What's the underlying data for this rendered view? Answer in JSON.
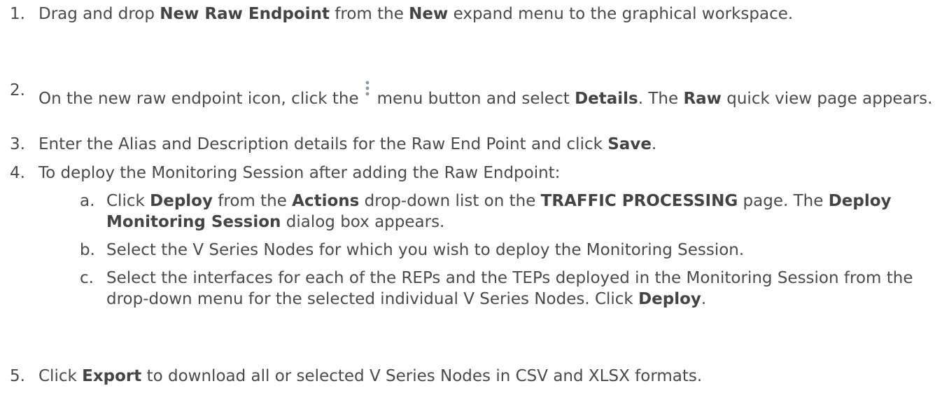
{
  "steps": [
    {
      "num": "1.",
      "parts": [
        "Drag and drop ",
        "New Raw Endpoint",
        " from the ",
        "New",
        " expand menu to the graphical workspace."
      ]
    },
    {
      "num": "2.",
      "parts": [
        "On the new raw endpoint icon, click the",
        "menu button and select ",
        "Details",
        ". The ",
        "Raw",
        " quick view page appears."
      ],
      "icon": "kebab-menu-icon"
    },
    {
      "num": "3.",
      "parts": [
        " Enter the Alias and Description details for the Raw End Point and click ",
        "Save",
        "."
      ]
    },
    {
      "num": "4.",
      "parts": [
        "To deploy the Monitoring Session after adding the Raw Endpoint:"
      ],
      "substeps": [
        {
          "letter": "a.",
          "parts": [
            "Click ",
            "Deploy",
            " from the ",
            "Actions",
            " drop-down list on the ",
            "TRAFFIC PROCESSING",
            " page. The ",
            "Deploy Monitoring Session",
            " dialog box appears."
          ]
        },
        {
          "letter": "b.",
          "parts": [
            "Select the V Series Nodes for which you wish to deploy the Monitoring Session."
          ]
        },
        {
          "letter": "c.",
          "parts": [
            "Select the interfaces for each of the REPs and the TEPs deployed in the Monitoring Session from the drop-down menu for the selected individual V Series Nodes. Click ",
            "Deploy",
            "."
          ]
        }
      ]
    },
    {
      "num": "5.",
      "parts": [
        "Click ",
        "Export",
        " to download all or selected V Series Nodes in CSV and XLSX formats."
      ]
    }
  ],
  "icon_color": "#8a99a6"
}
